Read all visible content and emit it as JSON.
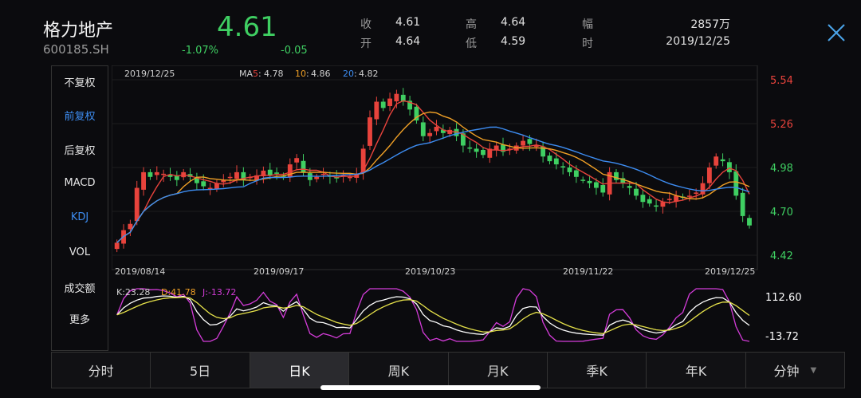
{
  "stock": {
    "name": "格力地产",
    "code": "600185.SH",
    "price": "4.61",
    "change_pct": "-1.07%",
    "change": "-0.05"
  },
  "quote": [
    {
      "label": "收",
      "value": "4.61"
    },
    {
      "label": "开",
      "value": "4.64"
    },
    {
      "label": "高",
      "value": "4.64"
    },
    {
      "label": "低",
      "value": "4.59"
    },
    {
      "label": "幅",
      "value": "2857万"
    },
    {
      "label": "时",
      "value": "2019/12/25"
    }
  ],
  "menu": [
    "不复权",
    "前复权",
    "后复权",
    "MACD",
    "KDJ",
    "VOL",
    "成交额",
    "更多"
  ],
  "menu_active": [
    1,
    4
  ],
  "chart_header": {
    "date": "2019/12/25",
    "ma5_label": "MA5:",
    "ma5_value": "4.78",
    "ma10_label": "10:",
    "ma10_value": "4.86",
    "ma20_label": "20:",
    "ma20_value": "4.82"
  },
  "kdj_header": {
    "k": "K:23.28",
    "d": "D:41.78",
    "j": "J:-13.72"
  },
  "kdj_axis": {
    "max": "112.60",
    "min": "-13.72"
  },
  "tabs": [
    "分时",
    "5日",
    "日K",
    "周K",
    "月K",
    "季K",
    "年K",
    "分钟"
  ],
  "active_tab": 2,
  "colors": {
    "up": "#e8433c",
    "down": "#3fcf62",
    "ma5": "#e8433c",
    "ma10": "#f0a026",
    "ma20": "#3d8df2",
    "k": "#ffffff",
    "d": "#e6e24a",
    "j": "#d43cd9"
  },
  "chart_data": {
    "type": "candlestick",
    "y_ticks": [
      5.54,
      5.26,
      4.98,
      4.7,
      4.42
    ],
    "ylim": [
      4.42,
      5.54
    ],
    "x_ticks": [
      "2019/08/14",
      "2019/09/17",
      "2019/10/23",
      "2019/11/22",
      "2019/12/25"
    ],
    "close": [
      4.5,
      4.58,
      4.62,
      4.85,
      4.95,
      4.92,
      4.95,
      4.94,
      4.92,
      4.9,
      4.95,
      4.92,
      4.88,
      4.86,
      4.85,
      4.88,
      4.9,
      4.92,
      4.95,
      4.9,
      4.92,
      4.93,
      4.96,
      4.93,
      4.94,
      4.92,
      5.0,
      5.04,
      4.95,
      4.9,
      4.92,
      4.94,
      4.92,
      4.91,
      4.93,
      4.92,
      4.94,
      5.1,
      5.3,
      5.4,
      5.36,
      5.42,
      5.45,
      5.4,
      5.35,
      5.28,
      5.18,
      5.2,
      5.24,
      5.2,
      5.22,
      5.18,
      5.12,
      5.1,
      5.08,
      5.06,
      5.1,
      5.12,
      5.08,
      5.1,
      5.12,
      5.15,
      5.13,
      5.12,
      5.05,
      5.02,
      5.0,
      4.98,
      4.95,
      4.92,
      4.9,
      4.88,
      4.85,
      4.82,
      4.95,
      4.9,
      4.88,
      4.85,
      4.8,
      4.76,
      4.75,
      4.73,
      4.76,
      4.78,
      4.8,
      4.79,
      4.8,
      4.82,
      4.88,
      4.98,
      5.05,
      5.02,
      4.95,
      4.8,
      4.67,
      4.61
    ],
    "kdj": {
      "axis": [
        112.6,
        -13.72
      ],
      "k_last": 23.28,
      "d_last": 41.78,
      "j_last": -13.72
    }
  }
}
